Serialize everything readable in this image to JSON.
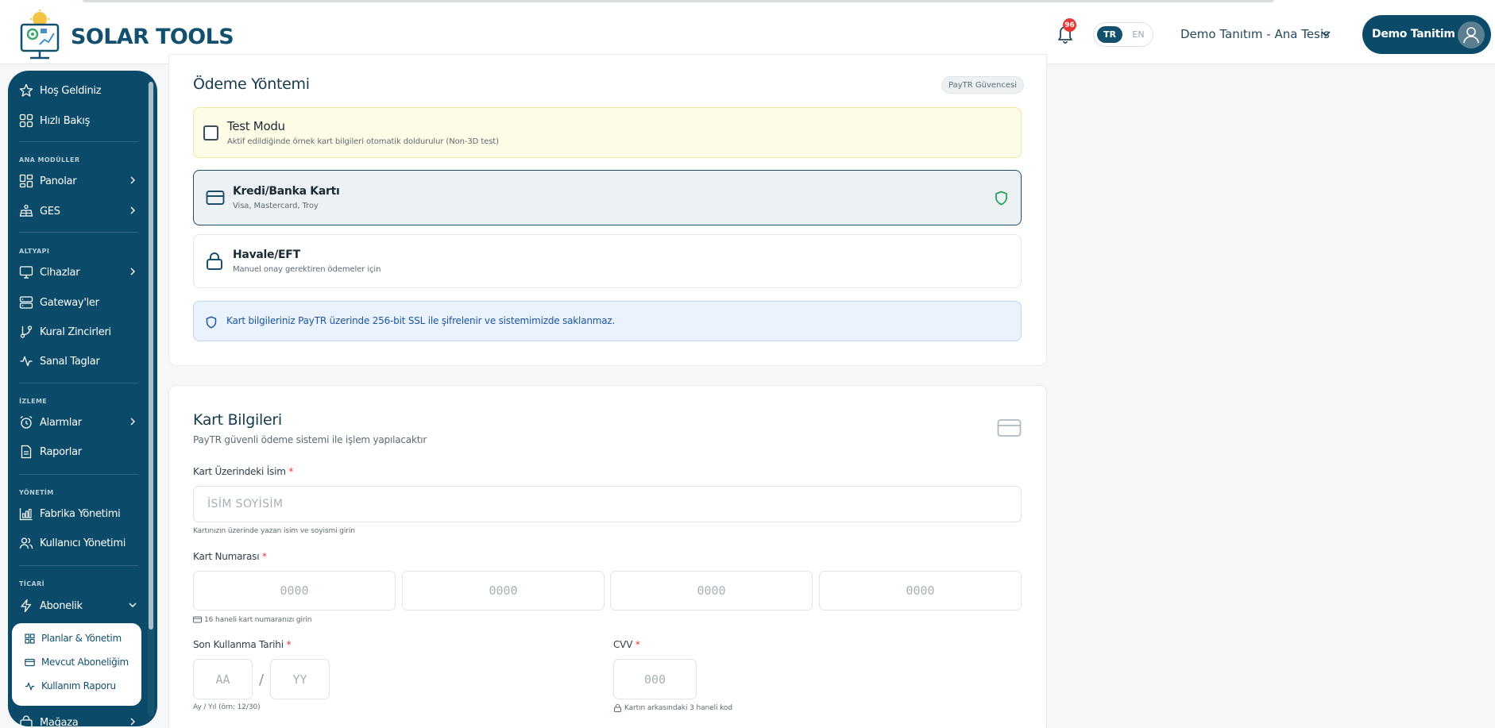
{
  "header": {
    "brand": "SOLAR TOOLS",
    "notification_count": "96",
    "lang_tr": "TR",
    "lang_en": "EN",
    "facility": "Demo Tanıtım - Ana Tesis",
    "user_name": "Demo Tanitim"
  },
  "sidebar": {
    "top_items": [
      "Hoş Geldiniz",
      "Hızlı Bakış"
    ],
    "sections": {
      "ana_moduller": "ANA MODÜLLER",
      "altyapi": "ALTYAPI",
      "izleme": "İZLEME",
      "yonetim": "YÖNETİM",
      "ticari": "TİCARİ"
    },
    "items": {
      "panolar": "Panolar",
      "ges": "GES",
      "cihazlar": "Cihazlar",
      "gateways": "Gateway'ler",
      "kural": "Kural Zincirleri",
      "sanal": "Sanal Taglar",
      "alarmlar": "Alarmlar",
      "raporlar": "Raporlar",
      "fabrika": "Fabrika Yönetimi",
      "kullanici": "Kullanıcı Yönetimi",
      "abonelik": "Abonelik",
      "magaza": "Mağaza"
    },
    "submenu": [
      "Planlar & Yönetim",
      "Mevcut Aboneliğim",
      "Kullanım Raporu"
    ]
  },
  "payment": {
    "title": "Ödeme Yöntemi",
    "badge": "PayTR Güvencesi",
    "test_mode": {
      "title": "Test Modu",
      "desc": "Aktif edildiğinde örnek kart bilgileri otomatik doldurulur (Non-3D test)",
      "checked": false
    },
    "card_option": {
      "title": "Kredi/Banka Kartı",
      "desc": "Visa, Mastercard, Troy"
    },
    "eft_option": {
      "title": "Havale/EFT",
      "desc": "Manuel onay gerektiren ödemeler için"
    },
    "info": "Kart bilgileriniz PayTR üzerinde 256-bit SSL ile şifrelenir ve sistemimizde saklanmaz."
  },
  "card_info": {
    "title": "Kart Bilgileri",
    "subtitle": "PayTR güvenli ödeme sistemi ile işlem yapılacaktır",
    "name_label": "Kart Üzerindeki İsim",
    "name_placeholder": "İSİM SOYİSİM",
    "name_hint": "Kartınızın üzerinde yazan isim ve soyismi girin",
    "number_label": "Kart Numarası",
    "number_placeholder": "0000",
    "number_hint": "16 haneli kart numaranızı girin",
    "expiry_label": "Son Kullanma Tarihi",
    "month_placeholder": "AA",
    "year_placeholder": "YY",
    "expiry_separator": "/",
    "expiry_hint": "Ay / Yıl (örn: 12/30)",
    "cvv_label": "CVV",
    "cvv_placeholder": "000",
    "cvv_hint": "Kartın arkasındaki 3 haneli kod",
    "required_mark": "*"
  },
  "colors": {
    "primary": "#0b4b69",
    "danger": "#e53935",
    "info_bg": "#eaf3fd",
    "warning_bg": "#fefbe6",
    "success": "#22a55a"
  }
}
